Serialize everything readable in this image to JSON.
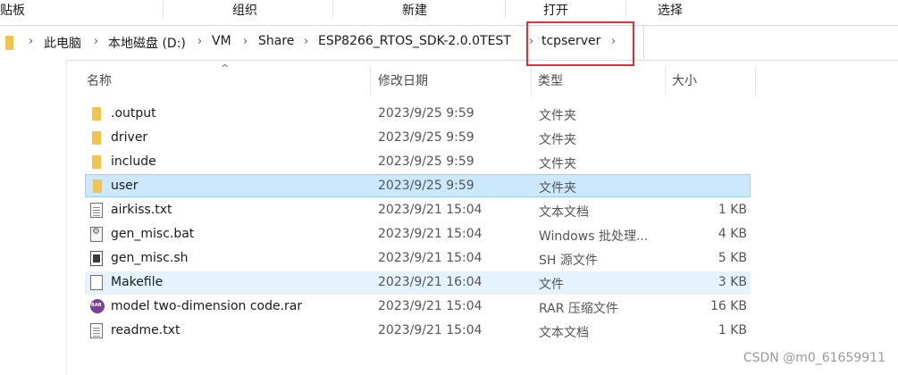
{
  "ribbon": {
    "groups": [
      {
        "label": "剪贴板"
      },
      {
        "label": "组织"
      },
      {
        "label": "新建"
      },
      {
        "label": "打开"
      },
      {
        "label": "选择"
      }
    ]
  },
  "address": {
    "segments": [
      "此电脑",
      "本地磁盘 (D:)",
      "VM",
      "Share",
      "ESP8266_RTOS_SDK-2.0.0TEST",
      "tcpserver"
    ],
    "highlighted_segment": "tcpserver",
    "highlight_color": "#e0303a"
  },
  "columns": {
    "name": "名称",
    "modified": "修改日期",
    "type": "类型",
    "size": "大小"
  },
  "files": [
    {
      "name": ".output",
      "modified": "2023/9/25 9:59",
      "type": "文件夹",
      "size": "",
      "icon": "folder-icon"
    },
    {
      "name": "driver",
      "modified": "2023/9/25 9:59",
      "type": "文件夹",
      "size": "",
      "icon": "folder-icon"
    },
    {
      "name": "include",
      "modified": "2023/9/25 9:59",
      "type": "文件夹",
      "size": "",
      "icon": "folder-icon"
    },
    {
      "name": "user",
      "modified": "2023/9/25 9:59",
      "type": "文件夹",
      "size": "",
      "icon": "folder-icon",
      "state": "selected"
    },
    {
      "name": "airkiss.txt",
      "modified": "2023/9/21 15:04",
      "type": "文本文档",
      "size": "1 KB",
      "icon": "text-file-icon"
    },
    {
      "name": "gen_misc.bat",
      "modified": "2023/9/21 15:04",
      "type": "Windows 批处理...",
      "size": "4 KB",
      "icon": "batch-file-icon"
    },
    {
      "name": "gen_misc.sh",
      "modified": "2023/9/21 15:04",
      "type": "SH 源文件",
      "size": "5 KB",
      "icon": "shell-file-icon"
    },
    {
      "name": "Makefile",
      "modified": "2023/9/21 16:04",
      "type": "文件",
      "size": "3 KB",
      "icon": "blank-file-icon",
      "state": "hover"
    },
    {
      "name": "model two-dimension code.rar",
      "modified": "2023/9/21 15:04",
      "type": "RAR 压缩文件",
      "size": "16 KB",
      "icon": "rar-archive-icon"
    },
    {
      "name": "readme.txt",
      "modified": "2023/9/21 15:04",
      "type": "文本文档",
      "size": "1 KB",
      "icon": "text-file-icon"
    }
  ],
  "watermark": "CSDN @m0_61659911",
  "colors": {
    "selected_bg": "#cce8ff",
    "selected_border": "#99d1ff",
    "hover_bg": "#e5f3ff",
    "folder": "#f0c44e"
  }
}
